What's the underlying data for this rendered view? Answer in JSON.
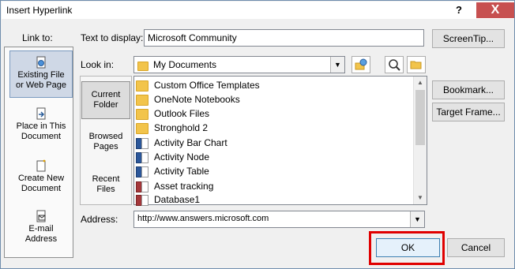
{
  "window": {
    "title": "Insert Hyperlink",
    "help_glyph": "?",
    "close_glyph": "X"
  },
  "link_to": {
    "label": "Link to:",
    "items": [
      {
        "line1": "Existing File",
        "line2": "or Web Page",
        "icon": "globe-file-icon",
        "selected": true
      },
      {
        "line1": "Place in This",
        "line2": "Document",
        "icon": "document-place-icon",
        "selected": false
      },
      {
        "line1": "Create New",
        "line2": "Document",
        "icon": "new-document-icon",
        "selected": false
      },
      {
        "line1": "E-mail",
        "line2": "Address",
        "icon": "email-icon",
        "selected": false
      }
    ]
  },
  "text_to_display": {
    "label": "Text to display:",
    "value": "Microsoft Community"
  },
  "screentip_button": "ScreenTip...",
  "look_in": {
    "label": "Look in:",
    "value": "My Documents"
  },
  "browse": {
    "items": [
      {
        "line1": "Current",
        "line2": "Folder",
        "selected": true
      },
      {
        "line1": "Browsed",
        "line2": "Pages",
        "selected": false
      },
      {
        "line1": "Recent",
        "line2": "Files",
        "selected": false
      }
    ]
  },
  "files": [
    {
      "name": "Custom Office Templates",
      "type": "folder"
    },
    {
      "name": "OneNote Notebooks",
      "type": "folder"
    },
    {
      "name": "Outlook Files",
      "type": "folder"
    },
    {
      "name": "Stronghold 2",
      "type": "folder"
    },
    {
      "name": "Activity Bar Chart",
      "type": "word"
    },
    {
      "name": "Activity Node",
      "type": "word"
    },
    {
      "name": "Activity Table",
      "type": "word"
    },
    {
      "name": "Asset tracking",
      "type": "access"
    },
    {
      "name": "Database1",
      "type": "access"
    }
  ],
  "right_buttons": {
    "bookmark": "Bookmark...",
    "target_frame": "Target Frame..."
  },
  "address": {
    "label": "Address:",
    "value": "http://www.answers.microsoft.com"
  },
  "footer": {
    "ok": "OK",
    "cancel": "Cancel"
  },
  "colors": {
    "highlight": "#e00000",
    "close_button": "#c75050"
  }
}
